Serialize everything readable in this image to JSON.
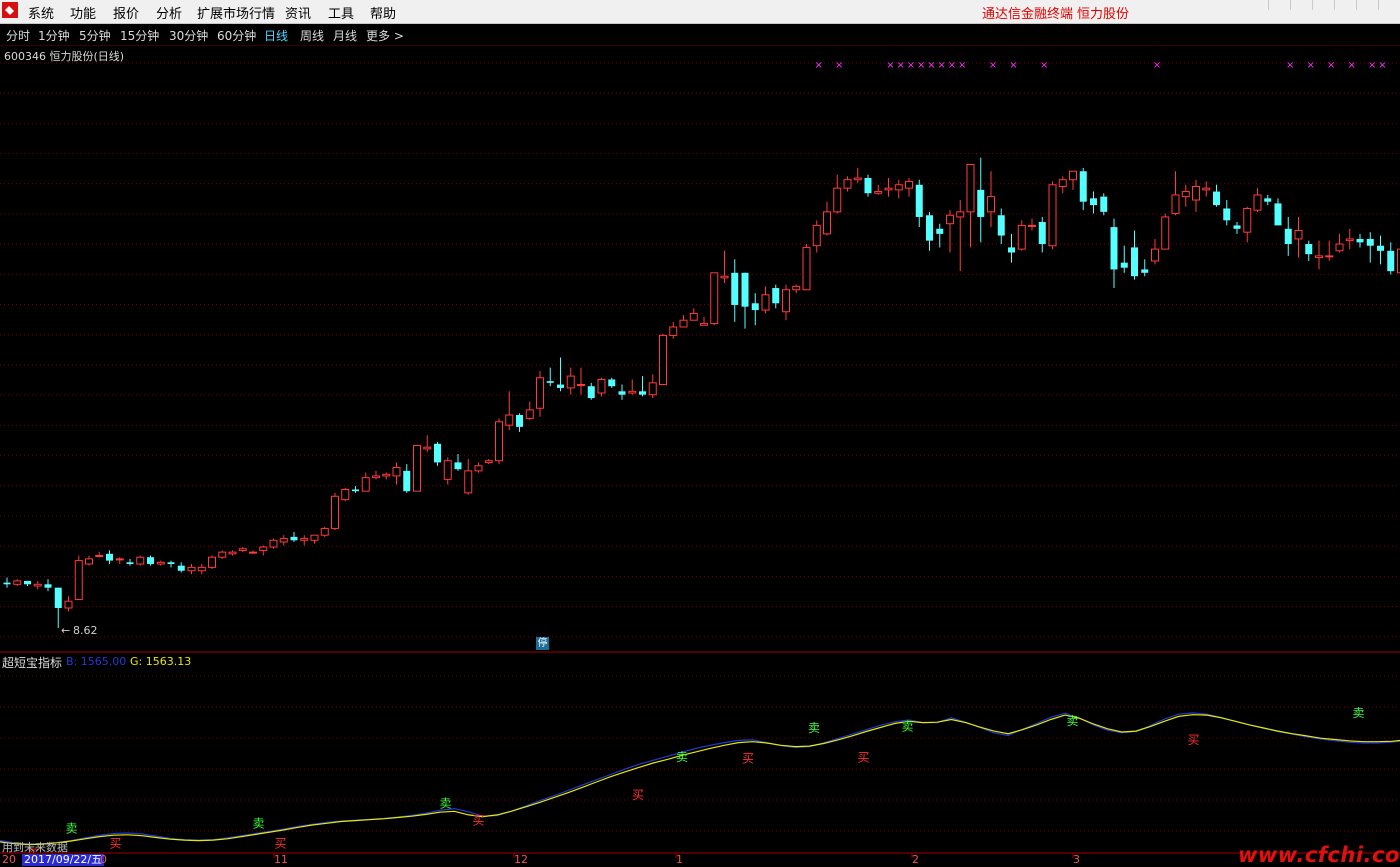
{
  "menubar": {
    "items": [
      "系统",
      "功能",
      "报价",
      "分析",
      "扩展市场行情",
      "资讯",
      "工具",
      "帮助"
    ],
    "brand_terminal": "通达信金融终端",
    "brand_stock": "恒力股份"
  },
  "periodbar": {
    "items": [
      "分时",
      "1分钟",
      "5分钟",
      "15分钟",
      "30分钟",
      "60分钟",
      "日线",
      "周线",
      "月线",
      "更多 >"
    ],
    "active": "日线"
  },
  "stock": {
    "title": "600346 恒力股份(日线)"
  },
  "price_panel": {
    "low_label": "8.62",
    "low_arrow": "←",
    "halt_badge": "停"
  },
  "indicator": {
    "name": "超短宝指标",
    "b_value": "B: 1565.00",
    "g_value": "G: 1563.13",
    "buy_label": "买",
    "sell_label": "卖"
  },
  "bottom": {
    "status_text": "用到未来数据",
    "date_left": "20",
    "date_badge": "2017/09/22/五",
    "month_labels": [
      "0",
      "11",
      "12",
      "1",
      "2",
      "3"
    ]
  },
  "colors": {
    "up": "#ff3b3b",
    "down": "#54ffff",
    "b_line": "#1f3bd6",
    "g_line": "#e8e800",
    "signal_x": "#ff2dff",
    "buy": "#ff3030",
    "sell": "#3cff3c",
    "grid": "#7a0000"
  },
  "watermark": "www.cfchi.com",
  "chart_data": {
    "type": "candlestick",
    "frequency": "daily",
    "start_date": "2017/09/22",
    "price_low": 8.62,
    "candles": [
      [
        11.3,
        11.6,
        11.0,
        11.2
      ],
      [
        11.2,
        11.5,
        11.1,
        11.4
      ],
      [
        11.4,
        11.4,
        11.1,
        11.2
      ],
      [
        11.1,
        11.4,
        10.9,
        11.2
      ],
      [
        11.2,
        11.5,
        10.8,
        11.0
      ],
      [
        11.0,
        11.0,
        8.62,
        9.8
      ],
      [
        9.8,
        10.5,
        9.6,
        10.2
      ],
      [
        10.3,
        12.9,
        10.3,
        12.6
      ],
      [
        12.4,
        12.9,
        12.3,
        12.7
      ],
      [
        12.9,
        13.1,
        12.8,
        12.9
      ],
      [
        13.0,
        13.2,
        12.4,
        12.6
      ],
      [
        12.7,
        12.8,
        12.4,
        12.7
      ],
      [
        12.5,
        12.7,
        12.3,
        12.4
      ],
      [
        12.4,
        12.9,
        12.3,
        12.8
      ],
      [
        12.8,
        12.9,
        12.3,
        12.4
      ],
      [
        12.4,
        12.6,
        12.3,
        12.5
      ],
      [
        12.5,
        12.6,
        12.2,
        12.4
      ],
      [
        12.3,
        12.5,
        11.9,
        12.0
      ],
      [
        12.0,
        12.4,
        11.8,
        12.2
      ],
      [
        12.0,
        12.4,
        11.8,
        12.2
      ],
      [
        12.2,
        12.9,
        12.1,
        12.8
      ],
      [
        12.8,
        13.2,
        12.7,
        13.1
      ],
      [
        13.0,
        13.2,
        12.9,
        13.1
      ],
      [
        13.2,
        13.4,
        13.1,
        13.3
      ],
      [
        13.1,
        13.2,
        13.0,
        13.1
      ],
      [
        13.2,
        13.5,
        12.9,
        13.4
      ],
      [
        13.4,
        13.9,
        13.3,
        13.8
      ],
      [
        13.7,
        14.1,
        13.5,
        13.9
      ],
      [
        14.0,
        14.3,
        13.7,
        13.8
      ],
      [
        13.8,
        14.1,
        13.5,
        13.9
      ],
      [
        13.8,
        14.0,
        13.6,
        14.1
      ],
      [
        14.1,
        14.6,
        14.0,
        14.5
      ],
      [
        14.5,
        16.6,
        14.4,
        16.4
      ],
      [
        16.2,
        16.9,
        16.1,
        16.8
      ],
      [
        16.8,
        17.0,
        16.6,
        16.7
      ],
      [
        16.7,
        17.8,
        16.7,
        17.5
      ],
      [
        17.5,
        17.9,
        17.4,
        17.6
      ],
      [
        17.6,
        17.8,
        17.4,
        17.7
      ],
      [
        17.6,
        18.4,
        17.1,
        18.1
      ],
      [
        17.9,
        18.3,
        16.6,
        16.7
      ],
      [
        16.7,
        19.4,
        16.7,
        19.4
      ],
      [
        19.2,
        20.0,
        19.0,
        19.3
      ],
      [
        19.5,
        19.6,
        18.2,
        18.4
      ],
      [
        17.4,
        18.7,
        17.1,
        18.5
      ],
      [
        18.4,
        18.9,
        17.9,
        18.0
      ],
      [
        16.6,
        18.6,
        16.5,
        17.9
      ],
      [
        17.9,
        18.4,
        17.8,
        18.2
      ],
      [
        18.4,
        18.6,
        18.3,
        18.5
      ],
      [
        18.5,
        21.0,
        18.3,
        20.8
      ],
      [
        20.6,
        22.6,
        20.3,
        21.2
      ],
      [
        21.2,
        21.3,
        20.2,
        20.5
      ],
      [
        21.0,
        22.0,
        20.9,
        21.5
      ],
      [
        21.6,
        23.8,
        21.1,
        23.4
      ],
      [
        23.2,
        24.0,
        22.9,
        23.1
      ],
      [
        23.0,
        24.6,
        22.6,
        22.8
      ],
      [
        22.8,
        24.0,
        22.4,
        23.5
      ],
      [
        23.0,
        24.0,
        22.4,
        23.0
      ],
      [
        22.9,
        23.1,
        22.1,
        22.2
      ],
      [
        22.5,
        23.4,
        22.3,
        23.3
      ],
      [
        23.3,
        23.4,
        22.8,
        22.9
      ],
      [
        22.6,
        23.0,
        22.1,
        22.4
      ],
      [
        22.5,
        23.3,
        22.4,
        22.6
      ],
      [
        22.6,
        23.5,
        22.3,
        22.4
      ],
      [
        22.4,
        23.6,
        22.2,
        23.1
      ],
      [
        23.0,
        26.0,
        23.0,
        25.9
      ],
      [
        25.9,
        26.7,
        25.7,
        26.4
      ],
      [
        26.4,
        27.1,
        26.4,
        26.8
      ],
      [
        26.8,
        27.5,
        26.9,
        27.2
      ],
      [
        26.5,
        27.0,
        26.5,
        26.6
      ],
      [
        26.6,
        29.0,
        26.5,
        29.6
      ],
      [
        29.3,
        30.9,
        29.0,
        29.4
      ],
      [
        29.6,
        30.4,
        26.7,
        27.7
      ],
      [
        29.6,
        29.6,
        26.3,
        27.6
      ],
      [
        27.8,
        28.4,
        26.5,
        27.4
      ],
      [
        27.4,
        28.8,
        27.2,
        28.3
      ],
      [
        28.7,
        28.9,
        27.5,
        27.8
      ],
      [
        27.3,
        28.9,
        26.8,
        28.6
      ],
      [
        28.6,
        28.9,
        28.4,
        28.8
      ],
      [
        28.6,
        31.3,
        28.6,
        31.1
      ],
      [
        31.2,
        32.7,
        30.8,
        32.4
      ],
      [
        31.9,
        33.8,
        31.8,
        33.2
      ],
      [
        33.2,
        35.4,
        33.1,
        34.6
      ],
      [
        34.6,
        35.3,
        34.4,
        35.1
      ],
      [
        35.1,
        35.8,
        34.9,
        35.2
      ],
      [
        35.2,
        35.4,
        34.1,
        34.3
      ],
      [
        34.3,
        34.8,
        34.2,
        34.4
      ],
      [
        34.5,
        35.2,
        34.1,
        34.6
      ],
      [
        34.5,
        35.1,
        34.0,
        34.8
      ],
      [
        34.6,
        35.2,
        34.1,
        35.0
      ],
      [
        34.8,
        35.1,
        32.3,
        32.9
      ],
      [
        33.0,
        33.2,
        30.9,
        31.5
      ],
      [
        32.2,
        32.5,
        31.1,
        31.9
      ],
      [
        32.5,
        33.3,
        30.8,
        33.0
      ],
      [
        32.9,
        33.9,
        29.7,
        33.2
      ],
      [
        33.2,
        35.7,
        31.1,
        36.0
      ],
      [
        34.5,
        36.4,
        31.4,
        32.9
      ],
      [
        33.2,
        35.6,
        32.3,
        34.1
      ],
      [
        33.0,
        33.4,
        31.3,
        31.8
      ],
      [
        31.1,
        31.9,
        30.2,
        30.8
      ],
      [
        31.0,
        32.7,
        30.9,
        32.4
      ],
      [
        32.4,
        32.8,
        32.1,
        32.4
      ],
      [
        32.6,
        32.9,
        30.8,
        31.3
      ],
      [
        31.2,
        35.0,
        31.0,
        34.8
      ],
      [
        34.7,
        35.3,
        34.3,
        35.1
      ],
      [
        35.1,
        35.4,
        34.5,
        35.6
      ],
      [
        35.6,
        35.8,
        33.3,
        33.8
      ],
      [
        34.0,
        34.4,
        33.1,
        33.6
      ],
      [
        34.1,
        34.3,
        33.0,
        33.2
      ],
      [
        32.3,
        32.8,
        28.7,
        29.8
      ],
      [
        30.2,
        31.2,
        29.6,
        29.9
      ],
      [
        31.1,
        32.1,
        29.2,
        29.4
      ],
      [
        29.8,
        30.4,
        29.4,
        29.6
      ],
      [
        30.3,
        31.6,
        30.1,
        31.0
      ],
      [
        31.0,
        33.1,
        31.0,
        32.9
      ],
      [
        33.1,
        35.6,
        33.0,
        34.2
      ],
      [
        34.1,
        34.8,
        33.5,
        34.4
      ],
      [
        33.9,
        35.1,
        33.2,
        34.7
      ],
      [
        34.5,
        35.0,
        34.1,
        34.6
      ],
      [
        34.4,
        34.8,
        33.5,
        33.6
      ],
      [
        33.4,
        33.9,
        32.4,
        32.7
      ],
      [
        32.4,
        32.6,
        31.9,
        32.2
      ],
      [
        32.0,
        33.5,
        31.4,
        33.4
      ],
      [
        33.3,
        34.6,
        33.2,
        34.2
      ],
      [
        34.0,
        34.2,
        33.6,
        33.8
      ],
      [
        33.7,
        34.0,
        33.2,
        32.4
      ],
      [
        32.2,
        32.9,
        30.6,
        31.3
      ],
      [
        31.6,
        32.9,
        30.5,
        32.1
      ],
      [
        31.3,
        31.5,
        30.3,
        30.7
      ],
      [
        30.5,
        31.5,
        29.8,
        30.6
      ],
      [
        30.6,
        31.5,
        30.3,
        30.6
      ],
      [
        30.9,
        31.9,
        30.8,
        31.3
      ],
      [
        31.5,
        32.2,
        31.0,
        31.6
      ],
      [
        31.6,
        31.9,
        31.1,
        31.4
      ],
      [
        31.6,
        32.0,
        30.2,
        31.2
      ],
      [
        31.2,
        31.8,
        30.1,
        30.9
      ],
      [
        30.9,
        31.4,
        29.5,
        29.7
      ],
      [
        29.6,
        31.9,
        29.2,
        31.0
      ],
      [
        31.3,
        31.6,
        31.2,
        31.5
      ],
      [
        31.5,
        32.3,
        31.3,
        31.4
      ],
      [
        31.6,
        32.2,
        31.3,
        31.5
      ],
      [
        31.5,
        32.0,
        31.2,
        31.3
      ]
    ],
    "signal_marker": "×",
    "signal_indices": [
      35,
      37,
      42,
      43,
      44,
      45,
      46,
      47,
      48,
      49,
      52,
      54,
      57,
      68,
      81,
      83,
      85,
      87,
      89,
      90,
      92,
      93,
      95,
      97,
      98,
      101,
      102,
      103,
      104,
      105,
      106,
      108,
      111,
      113,
      114,
      115,
      116,
      118,
      120,
      121,
      123,
      125,
      126,
      127,
      128,
      129,
      132
    ],
    "indicator_name": "超短宝指标",
    "indicator_b": [
      1290,
      1285,
      1282,
      1282,
      1285,
      1290,
      1296,
      1302,
      1306,
      1307,
      1305,
      1300,
      1295,
      1292,
      1291,
      1292,
      1296,
      1301,
      1306,
      1311,
      1316,
      1322,
      1327,
      1331,
      1334,
      1336,
      1338,
      1340,
      1343,
      1347,
      1352,
      1358,
      1362,
      1355,
      1345,
      1346,
      1356,
      1368,
      1380,
      1391,
      1403,
      1415,
      1427,
      1439,
      1451,
      1462,
      1471,
      1480,
      1489,
      1498,
      1505,
      1511,
      1516,
      1517,
      1511,
      1504,
      1500,
      1502,
      1510,
      1520,
      1530,
      1540,
      1550,
      1558,
      1562,
      1556,
      1556,
      1567,
      1557,
      1545,
      1533,
      1527,
      1541,
      1554,
      1568,
      1577,
      1567,
      1551,
      1539,
      1533,
      1536,
      1549,
      1564,
      1575,
      1578,
      1575,
      1568,
      1559,
      1551,
      1543,
      1536,
      1530,
      1524,
      1519,
      1515,
      1512,
      1510,
      1510,
      1512,
      1516
    ],
    "indicator_g": [
      1287,
      1283,
      1281,
      1282,
      1285,
      1289,
      1294,
      1299,
      1302,
      1303,
      1301,
      1297,
      1293,
      1291,
      1290,
      1291,
      1294,
      1299,
      1304,
      1309,
      1314,
      1320,
      1325,
      1329,
      1333,
      1335,
      1337,
      1339,
      1342,
      1345,
      1349,
      1354,
      1356,
      1348,
      1344,
      1348,
      1356,
      1366,
      1376,
      1387,
      1398,
      1410,
      1422,
      1434,
      1445,
      1455,
      1465,
      1473,
      1482,
      1490,
      1498,
      1505,
      1511,
      1513,
      1510,
      1505,
      1502,
      1503,
      1509,
      1517,
      1526,
      1536,
      1545,
      1554,
      1559,
      1556,
      1557,
      1563,
      1556,
      1546,
      1537,
      1531,
      1540,
      1551,
      1563,
      1573,
      1566,
      1553,
      1542,
      1535,
      1537,
      1547,
      1559,
      1570,
      1574,
      1573,
      1567,
      1559,
      1551,
      1544,
      1537,
      1531,
      1526,
      1521,
      1518,
      1515,
      1513,
      1513,
      1514,
      1517
    ],
    "buy_signal_indices": [
      6,
      21,
      51,
      87,
      116,
      136,
      157,
      217
    ],
    "sell_signal_indices": [
      13,
      47,
      81,
      124,
      148,
      165,
      195,
      247
    ],
    "last_b": 1565.0,
    "last_g": 1563.13
  }
}
